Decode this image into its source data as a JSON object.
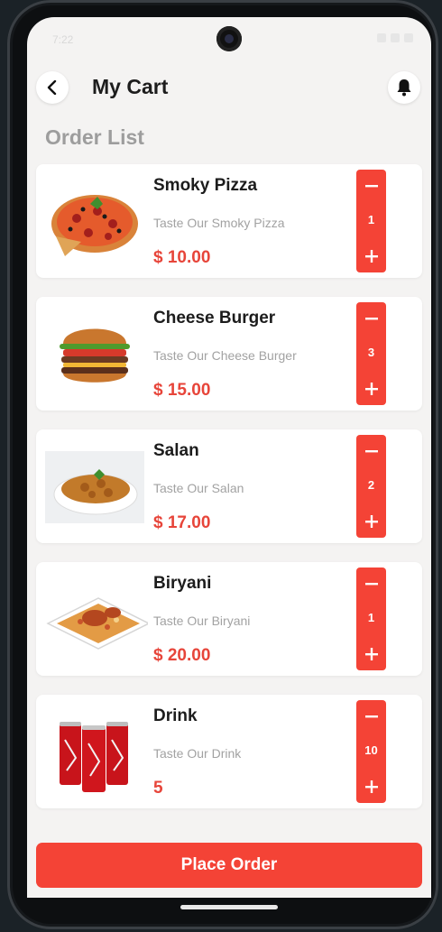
{
  "status_bar": {
    "time": "7:22"
  },
  "header": {
    "title": "My Cart"
  },
  "section_title": "Order List",
  "items": [
    {
      "name": "Smoky Pizza",
      "description": "Taste Our Smoky Pizza",
      "price": "$ 10.00",
      "quantity": "1",
      "image_icon": "pizza-image"
    },
    {
      "name": "Cheese Burger",
      "description": "Taste Our Cheese Burger",
      "price": "$ 15.00",
      "quantity": "3",
      "image_icon": "burger-image"
    },
    {
      "name": "Salan",
      "description": "Taste Our Salan",
      "price": "$ 17.00",
      "quantity": "2",
      "image_icon": "curry-bowl-image"
    },
    {
      "name": "Biryani",
      "description": "Taste Our Biryani",
      "price": "$ 20.00",
      "quantity": "1",
      "image_icon": "biryani-plate-image"
    },
    {
      "name": "Drink",
      "description": "Taste Our Drink",
      "price": "5",
      "quantity": "10",
      "image_icon": "cans-image"
    }
  ],
  "footer": {
    "place_order_label": "Place Order"
  },
  "colors": {
    "accent": "#f44336",
    "price": "#e7453a",
    "background": "#f4f3f2",
    "muted": "#9d9d9d"
  }
}
